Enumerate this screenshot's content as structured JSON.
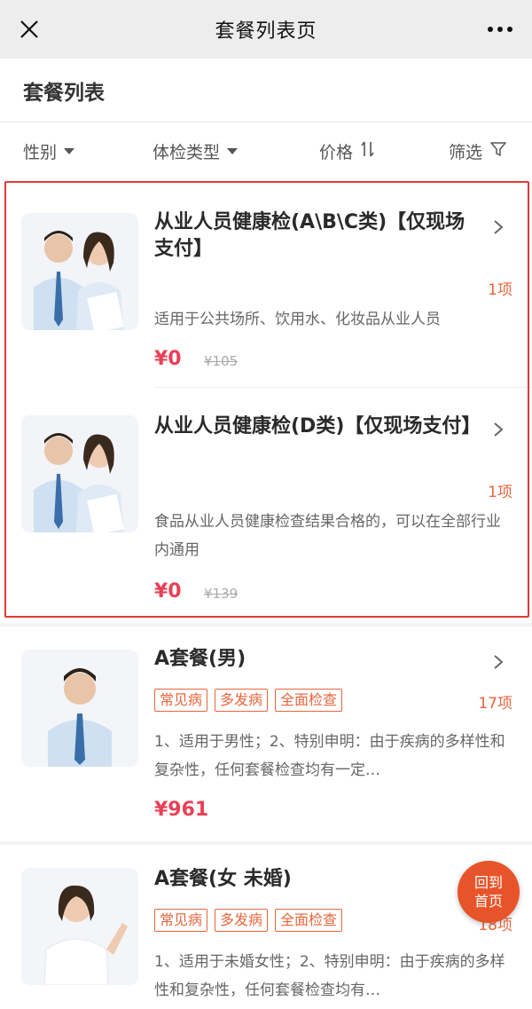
{
  "titlebar": {
    "title": "套餐列表页",
    "close_icon": "close-icon",
    "more_icon": "more-icon"
  },
  "section": {
    "title": "套餐列表"
  },
  "filters": [
    {
      "label": "性别",
      "icon": "triangle-down-icon"
    },
    {
      "label": "体检类型",
      "icon": "triangle-down-icon"
    },
    {
      "label": "价格",
      "icon": "sort-icon"
    },
    {
      "label": "筛选",
      "icon": "filter-icon"
    }
  ],
  "packages": [
    {
      "title": "从业人员健康检(A\\B\\C类)【仅现场支付】",
      "count": "1项",
      "desc": "适用于公共场所、饮用水、化妆品从业人员",
      "price": "¥0",
      "original_price": "¥105",
      "tags": []
    },
    {
      "title": "从业人员健康检(D类)【仅现场支付】",
      "count": "1项",
      "desc": "食品从业人员健康检查结果合格的，可以在全部行业内通用",
      "price": "¥0",
      "original_price": "¥139",
      "tags": []
    },
    {
      "title": "A套餐(男)",
      "count": "17项",
      "desc": "1、适用于男性；2、特别申明：由于疾病的多样性和复杂性，任何套餐检查均有一定…",
      "price": "¥961",
      "original_price": "",
      "tags": [
        "常见病",
        "多发病",
        "全面检查"
      ]
    },
    {
      "title": "A套餐(女 未婚)",
      "count": "18项",
      "desc": "1、适用于未婚女性；2、特别申明：由于疾病的多样性和复杂性，任何套餐检查均有…",
      "price": "",
      "original_price": "",
      "tags": [
        "常见病",
        "多发病",
        "全面检查"
      ]
    }
  ],
  "home_button": {
    "line1": "回到",
    "line2": "首页"
  },
  "colors": {
    "accent": "#e8663d",
    "price": "#e94057",
    "highlight_border": "#e53935",
    "home_button": "#e8542a"
  }
}
